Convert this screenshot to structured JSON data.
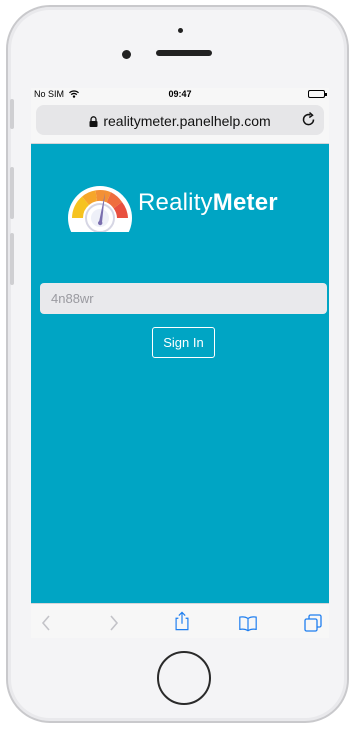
{
  "status_bar": {
    "carrier": "No SIM",
    "time": "09:47"
  },
  "browser": {
    "url": "realitymeter.panelhelp.com"
  },
  "brand": {
    "name_part1": "Reality",
    "name_part2": "Meter"
  },
  "login": {
    "code_value": "4n88wr",
    "sign_in_label": "Sign In"
  },
  "colors": {
    "background": "#00a5c4",
    "button_border": "#ffffff",
    "input_background": "#e9e9ec"
  },
  "icons": {
    "lock": "lock-icon",
    "reload": "reload-icon",
    "back": "chevron-left-icon",
    "forward": "chevron-right-icon",
    "share": "share-icon",
    "bookmarks": "book-icon",
    "tabs": "tabs-icon",
    "wifi": "wifi-icon",
    "battery": "battery-icon"
  }
}
